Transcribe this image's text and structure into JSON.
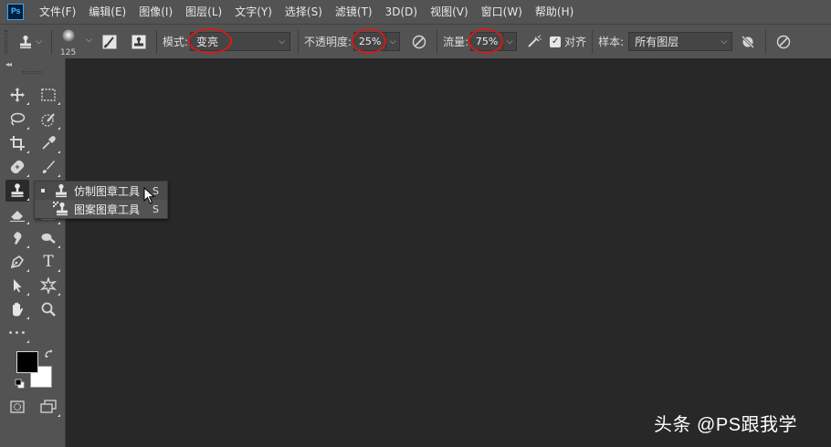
{
  "app": {
    "logo_text": "Ps"
  },
  "menubar": {
    "items": [
      {
        "label": "文件(F)"
      },
      {
        "label": "编辑(E)"
      },
      {
        "label": "图像(I)"
      },
      {
        "label": "图层(L)"
      },
      {
        "label": "文字(Y)"
      },
      {
        "label": "选择(S)"
      },
      {
        "label": "滤镜(T)"
      },
      {
        "label": "3D(D)"
      },
      {
        "label": "视图(V)"
      },
      {
        "label": "窗口(W)"
      },
      {
        "label": "帮助(H)"
      }
    ]
  },
  "options_bar": {
    "tool_preset_icon": "clone-stamp-icon",
    "brush_size": "125",
    "mode_label": "模式:",
    "mode_value": "变亮",
    "opacity_label": "不透明度:",
    "opacity_value": "25%",
    "flow_label": "流量:",
    "flow_value": "75%",
    "aligned_label": "对齐",
    "aligned_checked": true,
    "sample_label": "样本:",
    "sample_value": "所有图层",
    "highlight_color": "#d01c1c"
  },
  "toolbar": {
    "collapse_glyph": "◂◂",
    "tools": [
      {
        "name": "move-tool",
        "icon": "move-icon"
      },
      {
        "name": "marquee-tool",
        "icon": "rect-marquee-icon"
      },
      {
        "name": "lasso-tool",
        "icon": "lasso-icon"
      },
      {
        "name": "quick-select-tool",
        "icon": "quick-select-icon"
      },
      {
        "name": "crop-tool",
        "icon": "crop-icon"
      },
      {
        "name": "eyedropper-tool",
        "icon": "eyedropper-icon"
      },
      {
        "name": "healing-tool",
        "icon": "bandage-icon"
      },
      {
        "name": "brush-tool",
        "icon": "brush-icon"
      },
      {
        "name": "clone-stamp-tool",
        "icon": "clone-stamp-icon"
      },
      {
        "name": "history-brush-tool",
        "icon": "history-brush-icon"
      },
      {
        "name": "eraser-tool",
        "icon": "eraser-icon"
      },
      {
        "name": "gradient-tool",
        "icon": "gradient-icon"
      },
      {
        "name": "blur-tool",
        "icon": "blur-icon"
      },
      {
        "name": "dodge-tool",
        "icon": "dodge-icon"
      },
      {
        "name": "pen-tool",
        "icon": "pen-icon"
      },
      {
        "name": "type-tool",
        "icon": "type-icon"
      },
      {
        "name": "path-select-tool",
        "icon": "arrow-icon"
      },
      {
        "name": "shape-tool",
        "icon": "custom-shape-icon"
      },
      {
        "name": "hand-tool",
        "icon": "hand-icon"
      },
      {
        "name": "zoom-tool",
        "icon": "magnifier-icon"
      },
      {
        "name": "edit-toolbar",
        "icon": "ellipsis-icon"
      }
    ],
    "type_tool_glyph": "T",
    "more_glyph": "•••",
    "foreground_color": "#000000",
    "background_color": "#ffffff"
  },
  "flyout": {
    "items": [
      {
        "label": "仿制图章工具",
        "shortcut": "S",
        "selected": true
      },
      {
        "label": "图案图章工具",
        "shortcut": "S",
        "selected": false
      }
    ]
  },
  "watermark": {
    "text": "头条 @PS跟我学"
  }
}
